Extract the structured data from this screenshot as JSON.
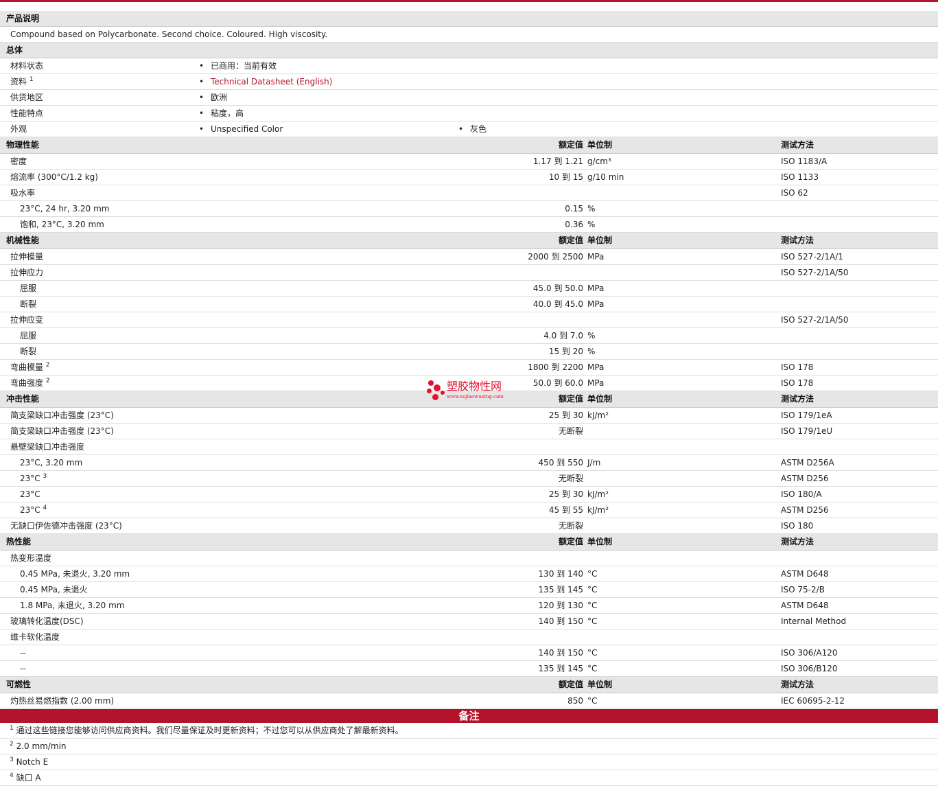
{
  "product_description": {
    "title": "产品说明",
    "text": "Compound based on Polycarbonate. Second choice. Coloured. High viscosity."
  },
  "general": {
    "title": "总体",
    "rows": [
      {
        "label": "材料状态",
        "values": [
          "已商用：当前有效"
        ]
      },
      {
        "label": "资料",
        "sup": "1",
        "values": [
          "Technical Datasheet (English)"
        ],
        "link": true
      },
      {
        "label": "供货地区",
        "values": [
          "欧洲"
        ]
      },
      {
        "label": "性能特点",
        "values": [
          "粘度，高"
        ]
      },
      {
        "label": "外观",
        "values": [
          "Unspecified Color",
          "灰色"
        ]
      }
    ]
  },
  "headers": {
    "nominal": "额定值",
    "unit": "单位制",
    "test": "测试方法"
  },
  "sections": [
    {
      "title": "物理性能",
      "rows": [
        {
          "label": "密度",
          "value": "1.17 到  1.21",
          "unit": "g/cm³",
          "test": "ISO 1183/A"
        },
        {
          "label": "熔流率  (300°C/1.2 kg)",
          "value": "10 到  15",
          "unit": "g/10 min",
          "test": "ISO 1133"
        },
        {
          "label": "吸水率",
          "test": "ISO 62"
        },
        {
          "label": "23°C, 24 hr, 3.20 mm",
          "indent": true,
          "value": "0.15",
          "unit": "%"
        },
        {
          "label": "饱和, 23°C, 3.20 mm",
          "indent": true,
          "value": "0.36",
          "unit": "%"
        }
      ]
    },
    {
      "title": "机械性能",
      "rows": [
        {
          "label": "拉伸模量",
          "value": "2000 到  2500",
          "unit": "MPa",
          "test": "ISO 527-2/1A/1"
        },
        {
          "label": "拉伸应力",
          "test": "ISO 527-2/1A/50"
        },
        {
          "label": "屈服",
          "indent": true,
          "value": "45.0 到  50.0",
          "unit": "MPa"
        },
        {
          "label": "断裂",
          "indent": true,
          "value": "40.0 到  45.0",
          "unit": "MPa"
        },
        {
          "label": "拉伸应变",
          "test": "ISO 527-2/1A/50"
        },
        {
          "label": "屈服",
          "indent": true,
          "value": "4.0 到  7.0",
          "unit": "%"
        },
        {
          "label": "断裂",
          "indent": true,
          "value": "15 到  20",
          "unit": "%"
        },
        {
          "label": "弯曲模量",
          "sup": "2",
          "value": "1800 到  2200",
          "unit": "MPa",
          "test": "ISO 178"
        },
        {
          "label": "弯曲强度",
          "sup": "2",
          "value": "50.0 到  60.0",
          "unit": "MPa",
          "test": "ISO 178"
        }
      ]
    },
    {
      "title": "冲击性能",
      "rows": [
        {
          "label": "简支梁缺口冲击强度  (23°C)",
          "value": "25 到  30",
          "unit": "kJ/m²",
          "test": "ISO 179/1eA"
        },
        {
          "label": "简支梁缺口冲击强度  (23°C)",
          "value": "无断裂",
          "test": "ISO 179/1eU"
        },
        {
          "label": "悬壁梁缺口冲击强度"
        },
        {
          "label": "23°C, 3.20 mm",
          "indent": true,
          "value": "450 到  550",
          "unit": "J/m",
          "test": "ASTM D256A"
        },
        {
          "label": "23°C",
          "sup": "3",
          "indent": true,
          "value": "无断裂",
          "test": "ASTM D256"
        },
        {
          "label": "23°C",
          "indent": true,
          "value": "25 到  30",
          "unit": "kJ/m²",
          "test": "ISO 180/A"
        },
        {
          "label": "23°C",
          "sup": "4",
          "indent": true,
          "value": "45 到  55",
          "unit": "kJ/m²",
          "test": "ASTM D256"
        },
        {
          "label": "无缺口伊佐德冲击强度  (23°C)",
          "value": "无断裂",
          "test": "ISO 180"
        }
      ]
    },
    {
      "title": "热性能",
      "rows": [
        {
          "label": "热变形温度"
        },
        {
          "label": "0.45 MPa, 未退火, 3.20 mm",
          "indent": true,
          "value": "130 到  140",
          "unit": "°C",
          "test": "ASTM D648"
        },
        {
          "label": "0.45 MPa, 未退火",
          "indent": true,
          "value": "135 到  145",
          "unit": "°C",
          "test": "ISO 75-2/B"
        },
        {
          "label": "1.8 MPa, 未退火, 3.20 mm",
          "indent": true,
          "value": "120 到  130",
          "unit": "°C",
          "test": "ASTM D648"
        },
        {
          "label": "玻璃转化温度(DSC)",
          "value": "140 到  150",
          "unit": "°C",
          "test": "Internal Method"
        },
        {
          "label": "维卡软化温度"
        },
        {
          "label": "--",
          "indent": true,
          "value": "140 到  150",
          "unit": "°C",
          "test": "ISO 306/A120"
        },
        {
          "label": "--",
          "indent": true,
          "value": "135 到  145",
          "unit": "°C",
          "test": "ISO 306/B120"
        }
      ]
    },
    {
      "title": "可燃性",
      "rows": [
        {
          "label": "灼热丝易燃指数  (2.00 mm)",
          "value": "850",
          "unit": "°C",
          "test": "IEC 60695-2-12"
        }
      ]
    }
  ],
  "notes": {
    "title": "备注",
    "items": [
      {
        "num": "1",
        "text": "通过这些链接您能够访问供应商资料。我们尽量保证及时更新资料；不过您可以从供应商处了解最新资料。"
      },
      {
        "num": "2",
        "text": "2.0 mm/min"
      },
      {
        "num": "3",
        "text": "Notch E"
      },
      {
        "num": "4",
        "text": "缺口  A"
      }
    ]
  },
  "watermark": {
    "text": "塑胶物性网",
    "url": "www.sujiaowuxing.com"
  },
  "colors": {
    "accent": "#b3132b",
    "section_bg": "#e6e6e6",
    "watermark": "#e8112d"
  }
}
